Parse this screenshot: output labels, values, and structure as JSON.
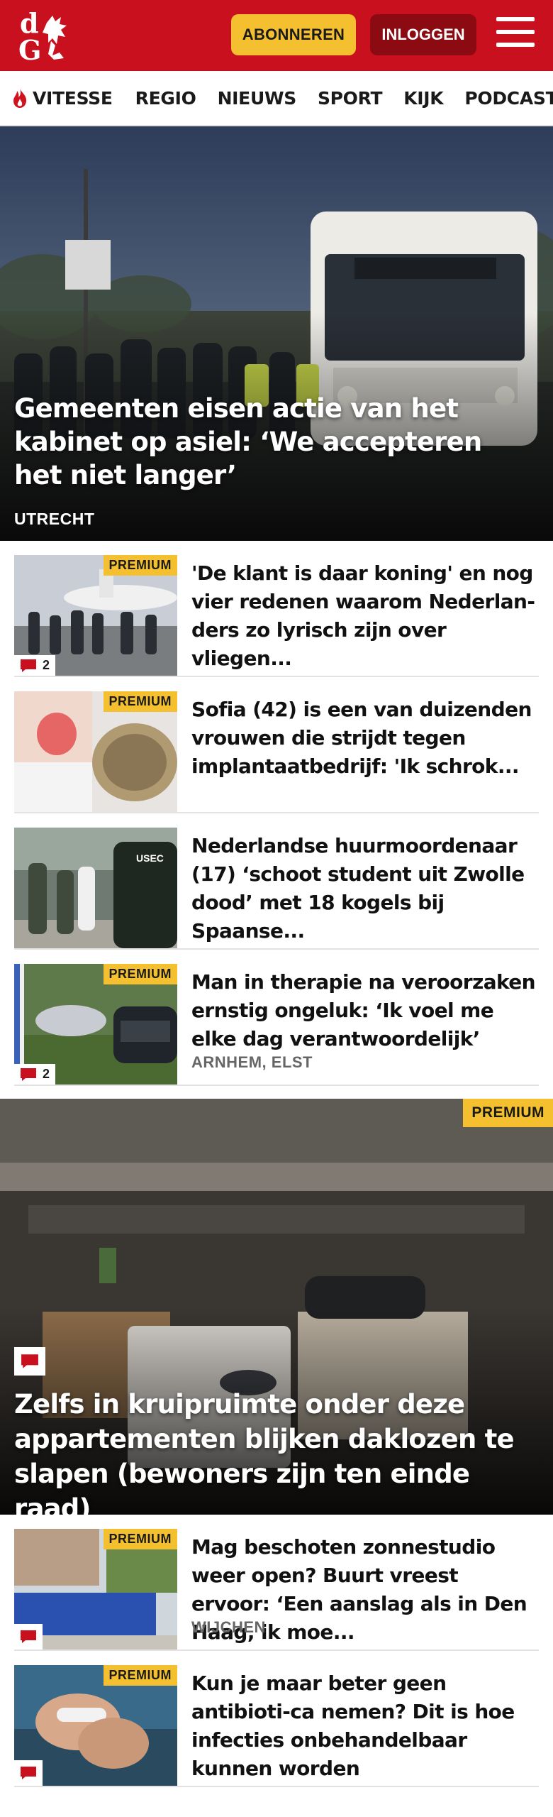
{
  "header": {
    "logo_text": "dG",
    "subscribe_label": "ABONNEREN",
    "login_label": "INLOGGEN"
  },
  "nav": {
    "items": [
      "VITESSE",
      "REGIO",
      "NIEUWS",
      "SPORT",
      "KIJK",
      "PODCAST"
    ]
  },
  "hero": {
    "title": "Gemeenten eisen actie van het kabinet op asiel: ‘We accepteren het niet langer’",
    "label": "UTRECHT"
  },
  "articles": [
    {
      "title": "'De klant is daar koning' en nog vier redenen waarom Nederlan-ders zo lyrisch zijn over vliegen...",
      "premium": "PREMIUM",
      "comments": "2",
      "label": ""
    },
    {
      "title": "Sofia (42) is een van duizenden vrouwen die strijdt tegen implantaatbedrijf: 'Ik schrok...",
      "premium": "PREMIUM",
      "comments": "",
      "label": ""
    },
    {
      "title": "Nederlandse huurmoordenaar (17) ‘schoot student uit Zwolle dood’ met 18 kogels bij Spaanse...",
      "premium": "",
      "comments": "",
      "label": ""
    },
    {
      "title": "Man in therapie na veroorzaken ernstig ongeluk: ‘Ik voel me elke dag verantwoordelijk’",
      "premium": "PREMIUM",
      "comments": "2",
      "label": "ARNHEM, ELST"
    }
  ],
  "feature": {
    "premium": "PREMIUM",
    "title": "Zelfs in kruipruimte onder deze appartementen blijken daklozen te slapen (bewoners zijn ten einde raad)"
  },
  "articles2": [
    {
      "title": "Mag beschoten zonnestudio weer open? Buurt vreest ervoor: ‘Een aanslag als in Den Haag, ik moe...",
      "premium": "PREMIUM",
      "label": "WIJCHEN"
    },
    {
      "title": "Kun je maar beter geen antibioti-ca nemen? Dit is hoe infecties onbehandelbaar kunnen worden",
      "premium": "PREMIUM",
      "label": ""
    }
  ],
  "colors": {
    "brand_red": "#c8101e",
    "premium_yellow": "#f4c030",
    "login_dark_red": "#8c0a12"
  }
}
